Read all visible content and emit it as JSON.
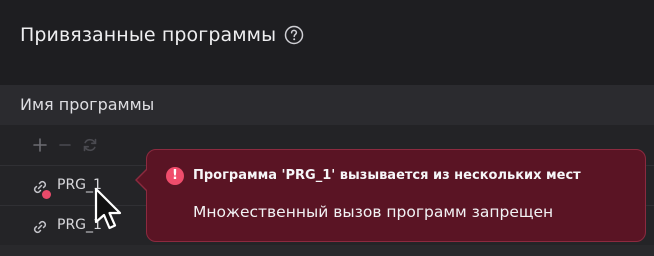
{
  "panel": {
    "title": "Привязанные программы",
    "help_icon": "question-circle-icon"
  },
  "table": {
    "column_header": "Имя программы",
    "toolbar": {
      "add_icon": "plus-icon",
      "remove_icon": "minus-icon",
      "refresh_icon": "refresh-icon"
    },
    "rows": [
      {
        "label": "PRG_1",
        "icon": "link-icon",
        "has_error": true
      },
      {
        "label": "PRG_1",
        "icon": "link-icon",
        "has_error": false
      }
    ]
  },
  "tooltip": {
    "icon": "exclamation-circle-icon",
    "title": "Программа 'PRG_1' вызывается из нескольких мест",
    "message": "Множественный вызов программ запрещен"
  },
  "colors": {
    "background": "#1f1f22",
    "error_accent": "#f04d6c",
    "tooltip_bg": "#5a1424",
    "tooltip_border": "#8c2a3f"
  }
}
